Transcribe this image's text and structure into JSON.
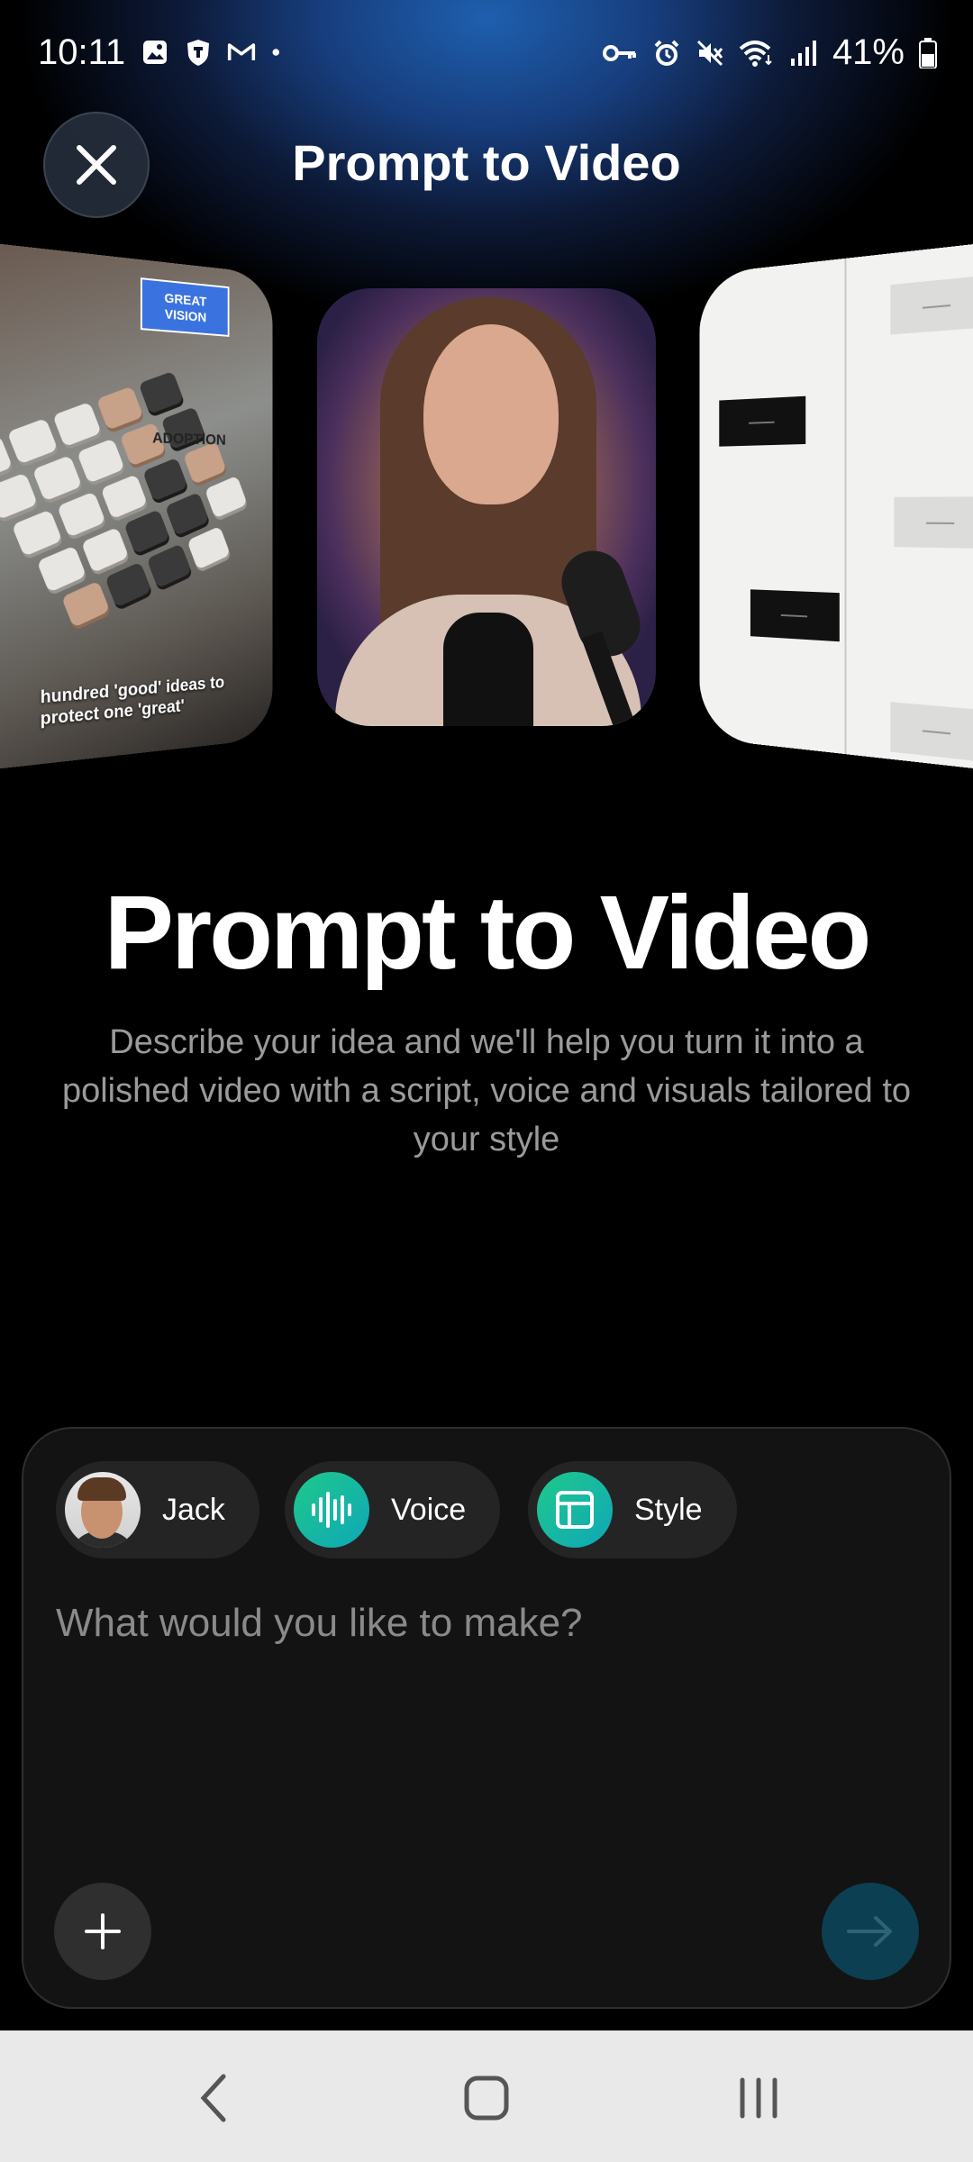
{
  "status_bar": {
    "time": "10:11",
    "battery": "41%",
    "left_icons": [
      "gallery-icon",
      "shield-icon",
      "gmail-icon",
      "dot-icon"
    ],
    "right_icons": [
      "vpn-key-icon",
      "alarm-icon",
      "mute-icon",
      "wifi-icon",
      "signal-icon",
      "battery-icon"
    ]
  },
  "header": {
    "title": "Prompt to Video",
    "close_icon": "close-icon"
  },
  "carousel": {
    "left_card": {
      "badge": "GREAT VISION",
      "overlay_text": "ADOPTION",
      "caption": "hundred 'good' ideas to protect one 'great'"
    }
  },
  "hero": {
    "title": "Prompt to Video",
    "description": "Describe your idea and we'll help you turn it into a polished video with a script, voice and visuals tailored to your style"
  },
  "composer": {
    "chips": [
      {
        "label": "Jack",
        "icon": "avatar"
      },
      {
        "label": "Voice",
        "icon": "waveform-icon"
      },
      {
        "label": "Style",
        "icon": "layout-icon"
      }
    ],
    "placeholder": "What would you like to make?",
    "value": "",
    "add_icon": "plus-icon",
    "send_icon": "arrow-right-icon",
    "accent_color": "#1ec98a",
    "send_color": "#0c3f52"
  },
  "nav_bar": {
    "buttons": [
      "back-icon",
      "home-icon",
      "recents-icon"
    ]
  }
}
